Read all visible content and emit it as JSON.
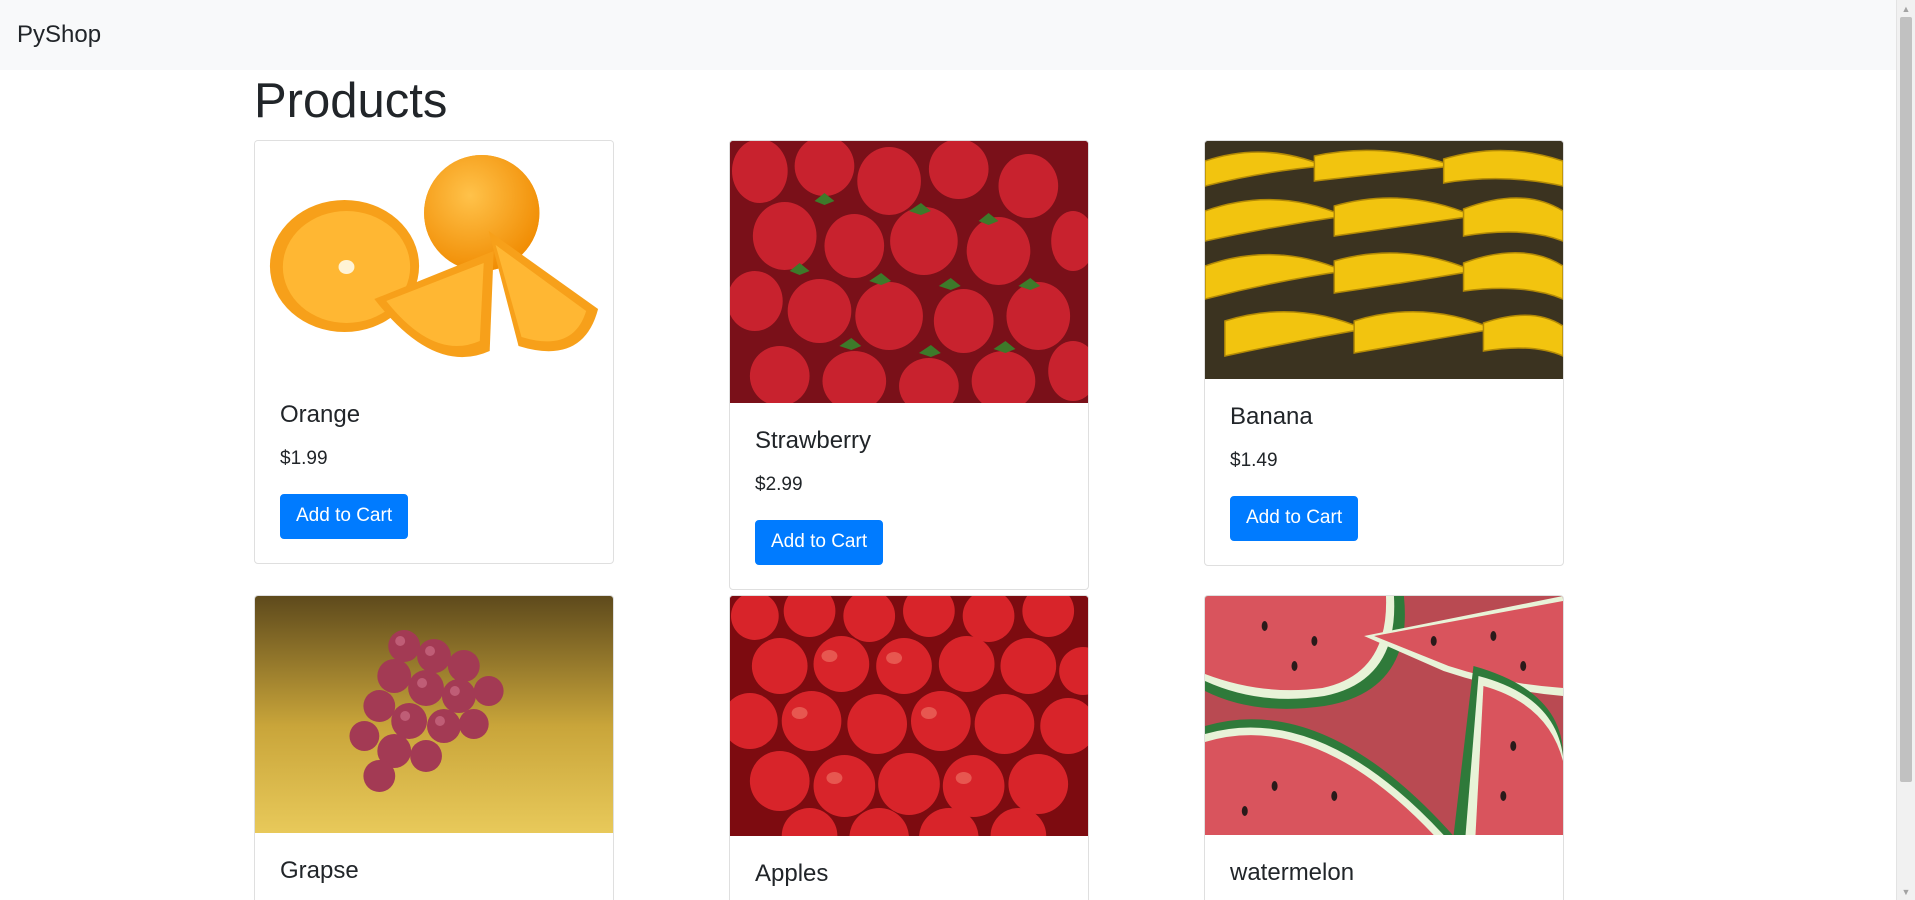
{
  "navbar": {
    "brand": "PyShop"
  },
  "page": {
    "title": "Products"
  },
  "products": [
    {
      "name": "Orange",
      "price": "$1.99",
      "button": "Add to Cart"
    },
    {
      "name": "Strawberry",
      "price": "$2.99",
      "button": "Add to Cart"
    },
    {
      "name": "Banana",
      "price": "$1.49",
      "button": "Add to Cart"
    },
    {
      "name": "Grapse",
      "price": "",
      "button": ""
    },
    {
      "name": "Apples",
      "price": "",
      "button": ""
    },
    {
      "name": "watermelon",
      "price": "",
      "button": ""
    }
  ],
  "colors": {
    "primary": "#007bff",
    "navbar_bg": "#f8f9fa",
    "text": "#212529"
  }
}
